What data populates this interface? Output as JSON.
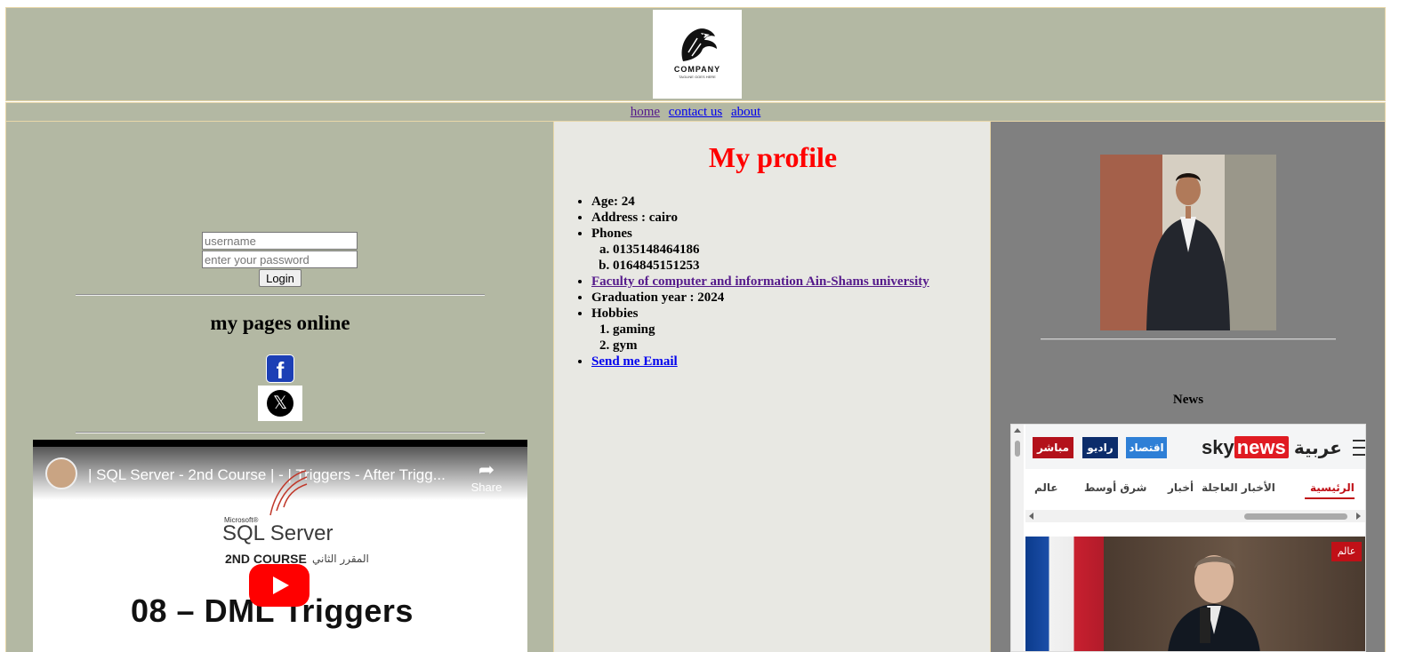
{
  "header": {
    "logo_text": "COMPANY",
    "logo_tagline": "TAGLINE GOES HERE"
  },
  "nav": {
    "links": [
      "home",
      "contact us",
      "about"
    ]
  },
  "login": {
    "username_placeholder": "username",
    "password_placeholder": "enter your password",
    "button_label": "Login"
  },
  "social": {
    "heading": "my pages online",
    "facebook_glyph": "f",
    "x_glyph": "𝕏"
  },
  "video": {
    "title": "| SQL Server - 2nd Course | - | Triggers - After Trigg...",
    "share_label": "Share",
    "ms_label": "Microsoft®",
    "product_label": "SQL Server",
    "course_label": "2ND COURSE",
    "arabic_label": "المقرر الثاني",
    "lesson_label": "08 – DML Triggers"
  },
  "profile": {
    "heading": "My profile",
    "age": "Age: 24",
    "address": "Address : cairo",
    "phones_label": "Phones",
    "phones": [
      "0135148464186",
      "0164845151253"
    ],
    "faculty_link": "Faculty of computer and information Ain-Shams university",
    "graduation": "Graduation year : 2024",
    "hobbies_label": "Hobbies",
    "hobbies": [
      "gaming",
      "gym"
    ],
    "email_link": "Send me Email"
  },
  "news": {
    "heading": "News",
    "badges": [
      "مباشر",
      "راديو",
      "اقتصاد"
    ],
    "brand_sky": "sky",
    "brand_news": "news",
    "brand_arabic": "عربية",
    "tabs": [
      "الرئيسية",
      "الأخبار العاجلة",
      "أخبار",
      "شرق أوسط",
      "عالم"
    ],
    "category_badge": "عالم"
  },
  "colors": {
    "panel_green": "#b3b8a3",
    "panel_light": "#e8e8e3",
    "panel_gray": "#808080",
    "heading_red": "#ff0000",
    "sky_red": "#e01b22"
  }
}
